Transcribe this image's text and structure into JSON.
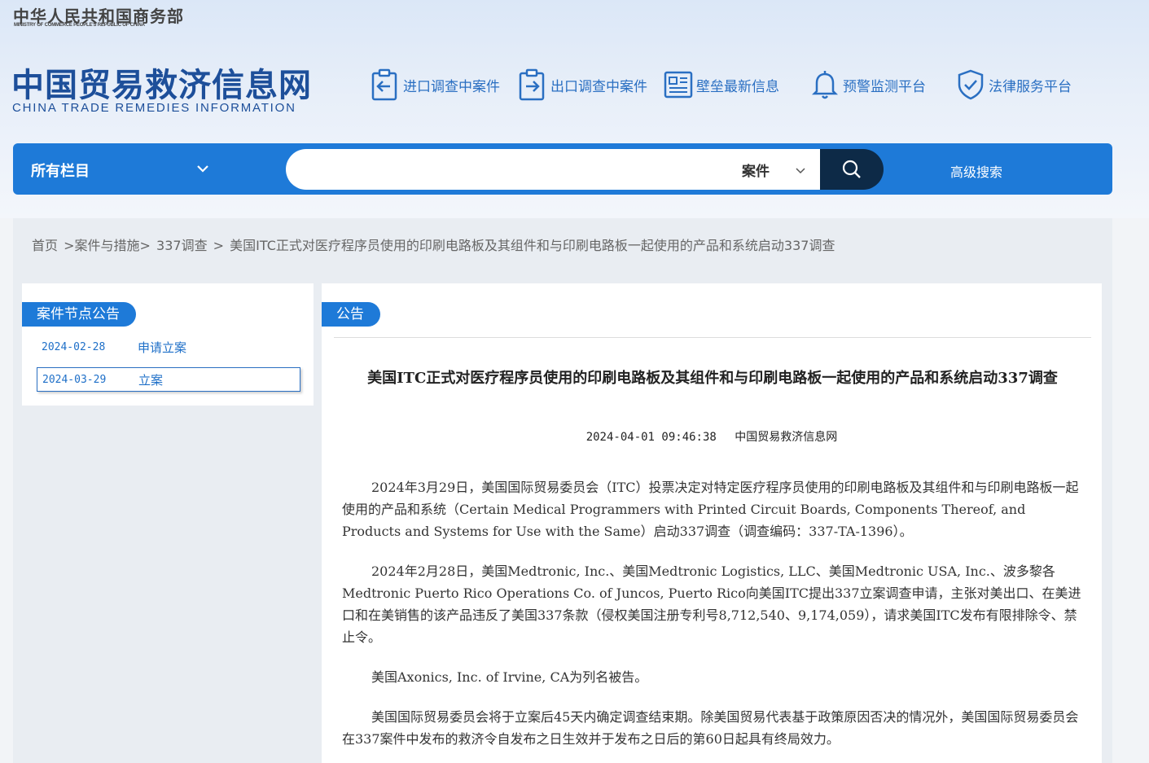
{
  "header": {
    "ministry_cn": "中华人民共和国商务部",
    "ministry_en": "MINISTRY OF COMMERCE PEOPLE'S REPUBLIC OF CHINA",
    "site_cn": "中国贸易救济信息网",
    "site_en": "CHINA TRADE REMEDIES INFORMATION",
    "nav": [
      {
        "label": "进口调查中案件",
        "icon": "import-clipboard-icon"
      },
      {
        "label": "出口调查中案件",
        "icon": "export-clipboard-icon"
      },
      {
        "label": "壁垒最新信息",
        "icon": "news-document-icon"
      },
      {
        "label": "预警监测平台",
        "icon": "bell-icon"
      },
      {
        "label": "法律服务平台",
        "icon": "shield-check-icon"
      }
    ]
  },
  "search": {
    "category": "所有栏目",
    "placeholder": "",
    "type": "案件",
    "advanced": "高级搜索"
  },
  "breadcrumb": [
    "首页",
    ">案件与措施>",
    "337调查",
    ">",
    "美国ITC正式对医疗程序员使用的印刷电路板及其组件和与印刷电路板一起使用的产品和系统启动337调查"
  ],
  "sidebar": {
    "title": "案件节点公告",
    "items": [
      {
        "date": "2024-02-28",
        "label": "申请立案"
      },
      {
        "date": "2024-03-29",
        "label": "立案"
      }
    ]
  },
  "article": {
    "tab": "公告",
    "title": "美国ITC正式对医疗程序员使用的印刷电路板及其组件和与印刷电路板一起使用的产品和系统启动337调查",
    "time": "2024-04-01 09:46:38",
    "source": "中国贸易救济信息网",
    "paragraphs": [
      "2024年3月29日，美国国际贸易委员会（ITC）投票决定对特定医疗程序员使用的印刷电路板及其组件和与印刷电路板一起使用的产品和系统（Certain Medical Programmers with Printed Circuit Boards, Components Thereof, and Products and Systems for Use with the Same）启动337调查（调查编码：337-TA-1396）。",
      "2024年2月28日，美国Medtronic, Inc.、美国Medtronic Logistics, LLC、美国Medtronic USA, Inc.、波多黎各Medtronic Puerto Rico Operations Co. of Juncos, Puerto Rico向美国ITC提出337立案调查申请，主张对美出口、在美进口和在美销售的该产品违反了美国337条款（侵权美国注册专利号8,712,540、9,174,059），请求美国ITC发布有限排除令、禁止令。",
      "美国Axonics, Inc. of Irvine, CA为列名被告。",
      "美国国际贸易委员会将于立案后45天内确定调查结束期。除美国贸易代表基于政策原因否决的情况外，美国国际贸易委员会在337案件中发布的救济令自发布之日生效并于发布之日后的第60日起具有终局效力。"
    ]
  },
  "colors": {
    "primary": "#1e7ad8",
    "dark_search": "#0d2a47",
    "brand_text": "#1d4f9a",
    "nav_text": "#2a6fc2"
  }
}
